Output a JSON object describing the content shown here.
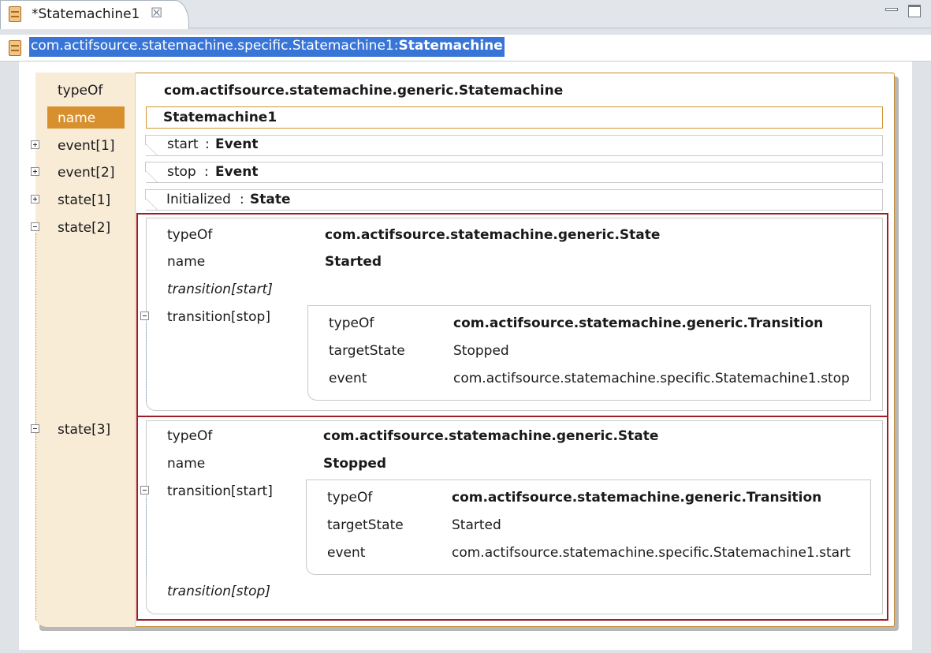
{
  "tab": {
    "title": "*Statemachine1",
    "close_glyph": "☒"
  },
  "header": {
    "path_plain": "com.actifsource.statemachine.specific.Statemachine1:",
    "path_type": "Statemachine"
  },
  "statemachine": {
    "typeOf_label": "typeOf",
    "typeOf_value": "com.actifsource.statemachine.generic.Statemachine",
    "name_label": "name",
    "name_value": "Statemachine1",
    "event1_label": "event[1]",
    "event1_name": "start",
    "event1_type": "Event",
    "event2_label": "event[2]",
    "event2_name": "stop",
    "event2_type": "Event",
    "state1_label": "state[1]",
    "state1_name": "Initialized",
    "state1_type": "State",
    "state2_label": "state[2]",
    "state3_label": "state[3]",
    "separator": ":"
  },
  "state2": {
    "typeOf_label": "typeOf",
    "typeOf_value": "com.actifsource.statemachine.generic.State",
    "name_label": "name",
    "name_value": "Started",
    "transition_start_label": "transition[start]",
    "transition_stop_label": "transition[stop]",
    "transition": {
      "typeOf_label": "typeOf",
      "typeOf_value": "com.actifsource.statemachine.generic.Transition",
      "target_label": "targetState",
      "target_value": "Stopped",
      "event_label": "event",
      "event_value": "com.actifsource.statemachine.specific.Statemachine1.stop"
    }
  },
  "state3": {
    "typeOf_label": "typeOf",
    "typeOf_value": "com.actifsource.statemachine.generic.State",
    "name_label": "name",
    "name_value": "Stopped",
    "transition_start_label": "transition[start]",
    "transition_stop_label": "transition[stop]",
    "transition": {
      "typeOf_label": "typeOf",
      "typeOf_value": "com.actifsource.statemachine.generic.Transition",
      "target_label": "targetState",
      "target_value": "Started",
      "event_label": "event",
      "event_value": "com.actifsource.statemachine.specific.Statemachine1.start"
    }
  },
  "colors": {
    "accent_orange": "#d8902f",
    "label_column": "#f8ecd7",
    "selection_blue": "#3875d7",
    "state_border_red": "#a01c25"
  },
  "icons": {
    "tab_icon": "resource-document-icon",
    "header_icon": "resource-document-icon",
    "close": "close-tab-icon",
    "minimize": "minimize-icon",
    "maximize": "maximize-icon",
    "expand": "expand-plus-icon",
    "collapse": "collapse-minus-icon"
  }
}
